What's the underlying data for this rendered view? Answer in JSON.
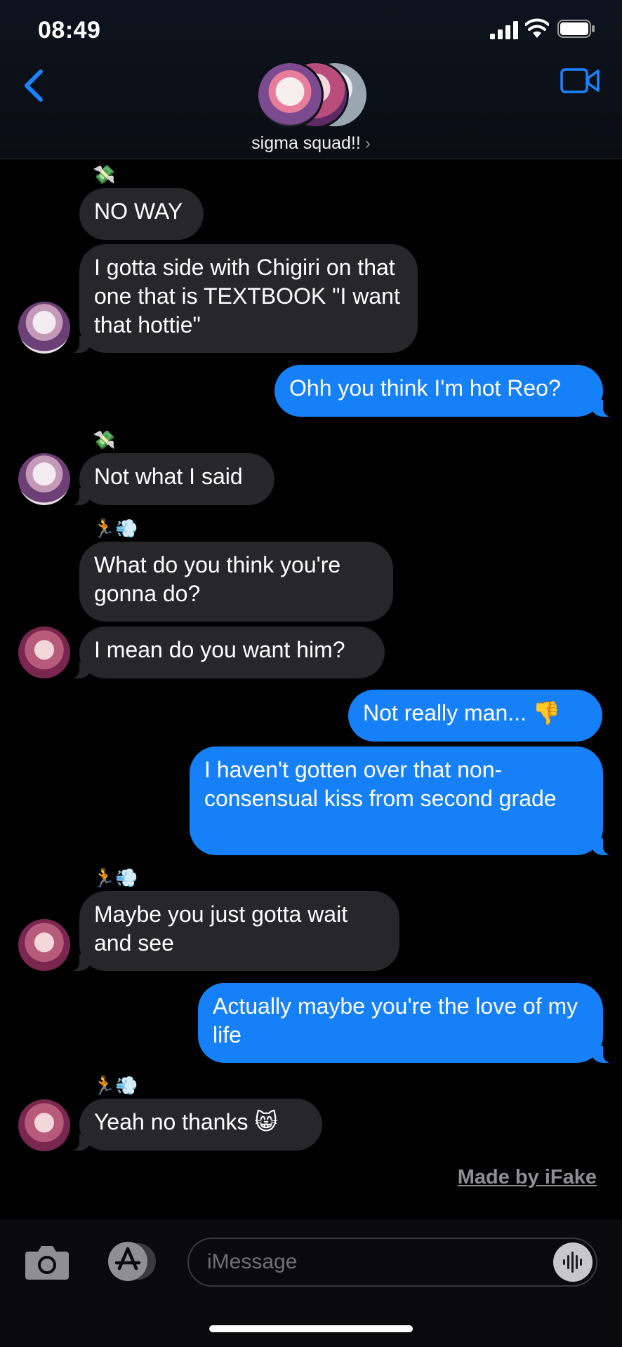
{
  "status_bar": {
    "time": "08:49"
  },
  "header": {
    "group_name": "sigma squad!!",
    "chevron": "›"
  },
  "messages": [
    {
      "text": "NO WAY"
    },
    {
      "text": "I gotta side with Chigiri on that one that is TEXTBOOK \"I want that hottie\""
    },
    {
      "text": "Ohh you think I'm hot Reo?"
    },
    {
      "text": "Not what I said"
    },
    {
      "text": "What do you think you're gonna do?"
    },
    {
      "text": "I mean do you want him?"
    },
    {
      "text": "Not really man... 👎"
    },
    {
      "text": "I haven't gotten over that non-consensual kiss from second grade"
    },
    {
      "text": "Maybe you just gotta wait and see"
    },
    {
      "text": "Actually maybe you're the love of my life"
    },
    {
      "text": "Yeah no thanks 😸"
    }
  ],
  "sender_emojis": {
    "money": "💸",
    "runner": "🏃💨"
  },
  "watermark": "Made by iFake",
  "input": {
    "placeholder": "iMessage"
  },
  "colors": {
    "sent": "#1680f8",
    "received": "#27272a",
    "accent": "#1a84ff"
  }
}
